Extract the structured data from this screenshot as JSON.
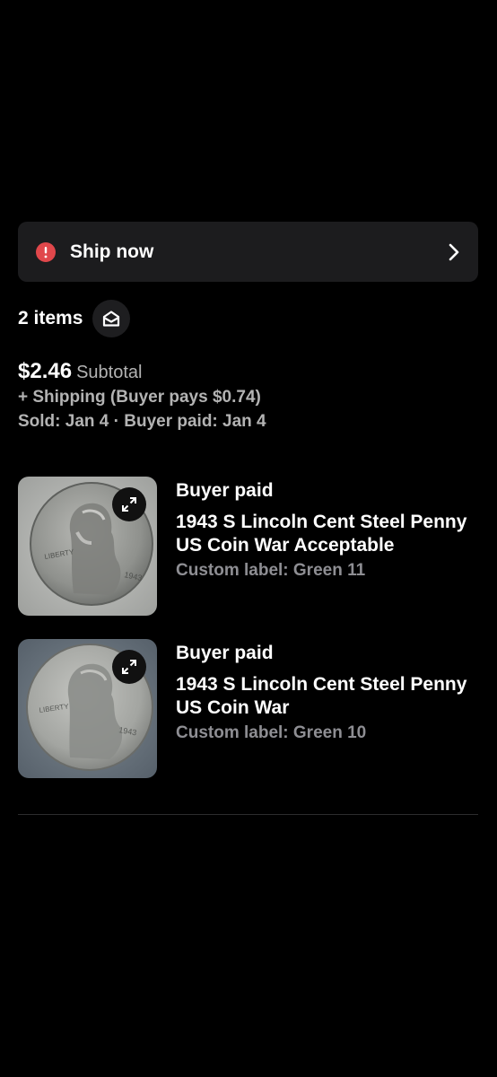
{
  "banner": {
    "label": "Ship now",
    "icon": "alert-circle-icon",
    "chevron": "chevron-right-icon",
    "alert_color": "#e0474b"
  },
  "order": {
    "items_count_label": "2 items",
    "contact_icon": "mail-open-icon",
    "price": "$2.46",
    "subtotal_label": "Subtotal",
    "shipping_line": "+ Shipping (Buyer pays $0.74)",
    "dates_line": "Sold: Jan 4 · Buyer paid: Jan 4"
  },
  "items": [
    {
      "status": "Buyer paid",
      "title": "1943 S Lincoln Cent Steel Penny US Coin War Acceptable",
      "custom_label": "Custom label: Green 11",
      "thumbnail": "steel-penny-photo",
      "expand_icon": "expand-icon"
    },
    {
      "status": "Buyer paid",
      "title": "1943 S Lincoln Cent Steel Penny US Coin War",
      "custom_label": "Custom label: Green 10",
      "thumbnail": "steel-penny-photo",
      "expand_icon": "expand-icon"
    }
  ]
}
